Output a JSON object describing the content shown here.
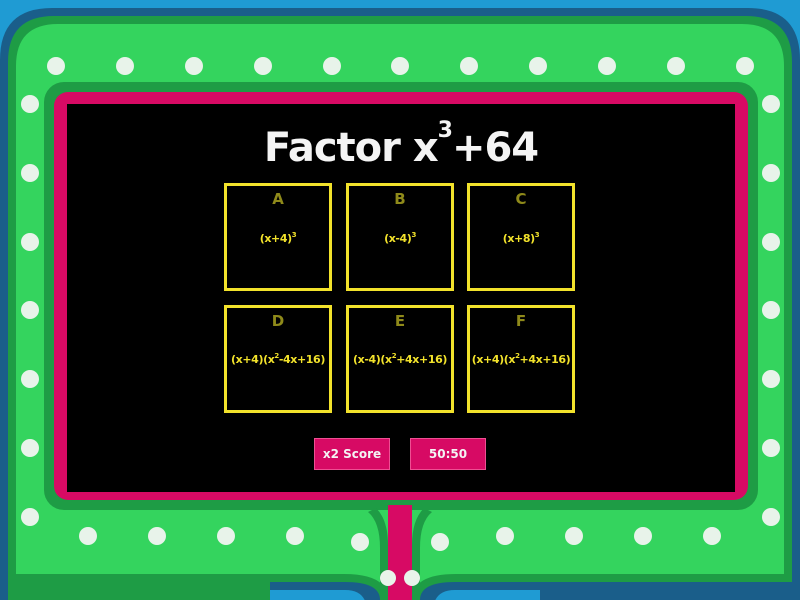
{
  "question": {
    "prefix": "Factor x",
    "exponent": "3",
    "suffix": "+64"
  },
  "answers": [
    {
      "letter": "A",
      "pre": "(x+4)",
      "sup": "3",
      "post": ""
    },
    {
      "letter": "B",
      "pre": "(x-4)",
      "sup": "3",
      "post": ""
    },
    {
      "letter": "C",
      "pre": "(x+8)",
      "sup": "3",
      "post": ""
    },
    {
      "letter": "D",
      "pre": "(x+4)(x",
      "sup": "2",
      "post": "-4x+16)"
    },
    {
      "letter": "E",
      "pre": "(x-4)(x",
      "sup": "2",
      "post": "+4x+16)"
    },
    {
      "letter": "F",
      "pre": "(x+4)(x",
      "sup": "2",
      "post": "+4x+16)"
    }
  ],
  "powerups": {
    "double_score": "x2 Score",
    "fifty_fifty": "50:50"
  },
  "colors": {
    "background": "#1f9bd3",
    "frame_green": "#2fd25a",
    "frame_dark_green": "#1a9a43",
    "board_magenta": "#d70a64",
    "screen": "#000000",
    "tile_border": "#f2e22b",
    "letter": "#8f8a1a"
  }
}
